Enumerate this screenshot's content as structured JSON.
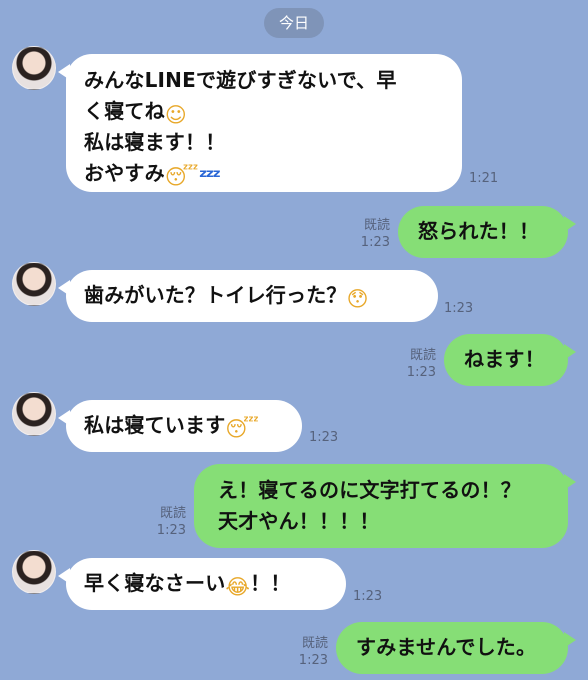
{
  "date_label": "今日",
  "messages": [
    {
      "side": "in",
      "lines": [
        "みんなLINEで遊びすぎないで、早",
        "く寝てね",
        "私は寝ます！！",
        "おやすみ"
      ],
      "time": "1:21"
    },
    {
      "side": "out",
      "text": "怒られた！！",
      "read": "既読",
      "time": "1:23"
    },
    {
      "side": "in",
      "text": "歯みがいた？トイレ行った？",
      "time": "1:23"
    },
    {
      "side": "out",
      "text": "ねます！",
      "read": "既読",
      "time": "1:23"
    },
    {
      "side": "in",
      "text": "私は寝ています",
      "time": "1:23"
    },
    {
      "side": "out",
      "lines": [
        "え！寝てるのに文字打てるの！？",
        "天才やん！！！！"
      ],
      "read": "既読",
      "time": "1:23"
    },
    {
      "side": "in",
      "text": "早く寝なさーい",
      "text_after": "！！",
      "time": "1:23"
    },
    {
      "side": "out",
      "text": "すみませんでした。",
      "read": "既読",
      "time": "1:23"
    }
  ],
  "emoji": {
    "relieved": "☺",
    "sleeping": "😴",
    "zzz": "ᶻᶻᶻ",
    "surprised": "😯",
    "joy": "😂"
  },
  "colors": {
    "background": "#8fa9d6",
    "incoming_bubble": "#ffffff",
    "outgoing_bubble": "#86de76",
    "meta_text": "#56627c"
  }
}
